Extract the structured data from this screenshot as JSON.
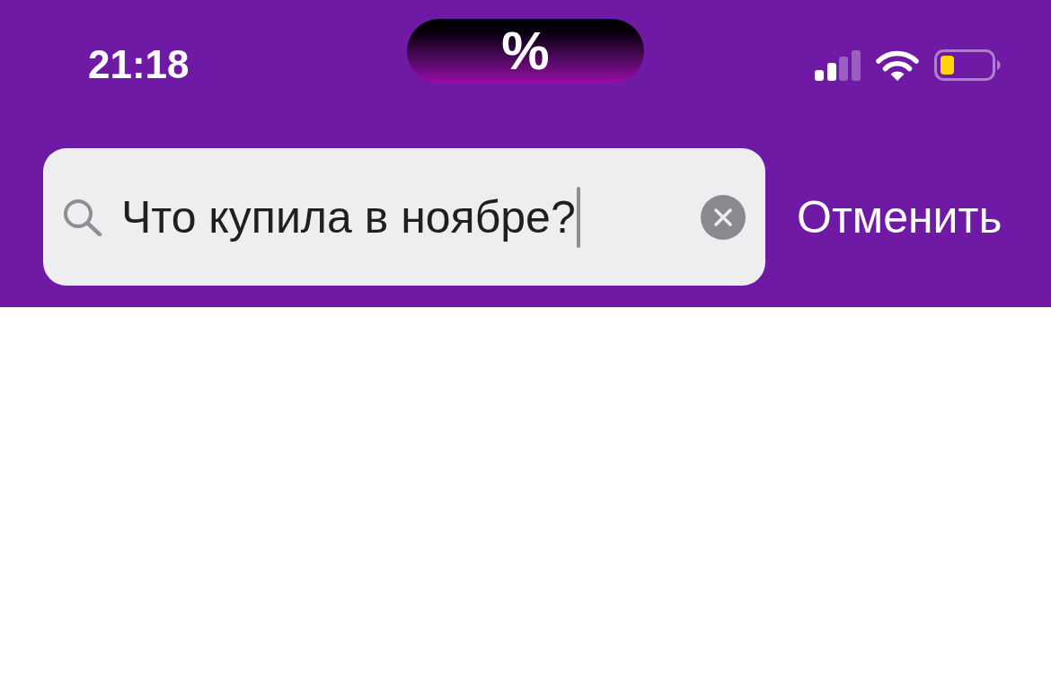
{
  "status_bar": {
    "time": "21:18"
  },
  "dynamic_island": {
    "text": "%"
  },
  "search": {
    "value": "Что купила в ноябре?",
    "focused": true
  },
  "cancel_button": {
    "label": "Отменить"
  }
}
